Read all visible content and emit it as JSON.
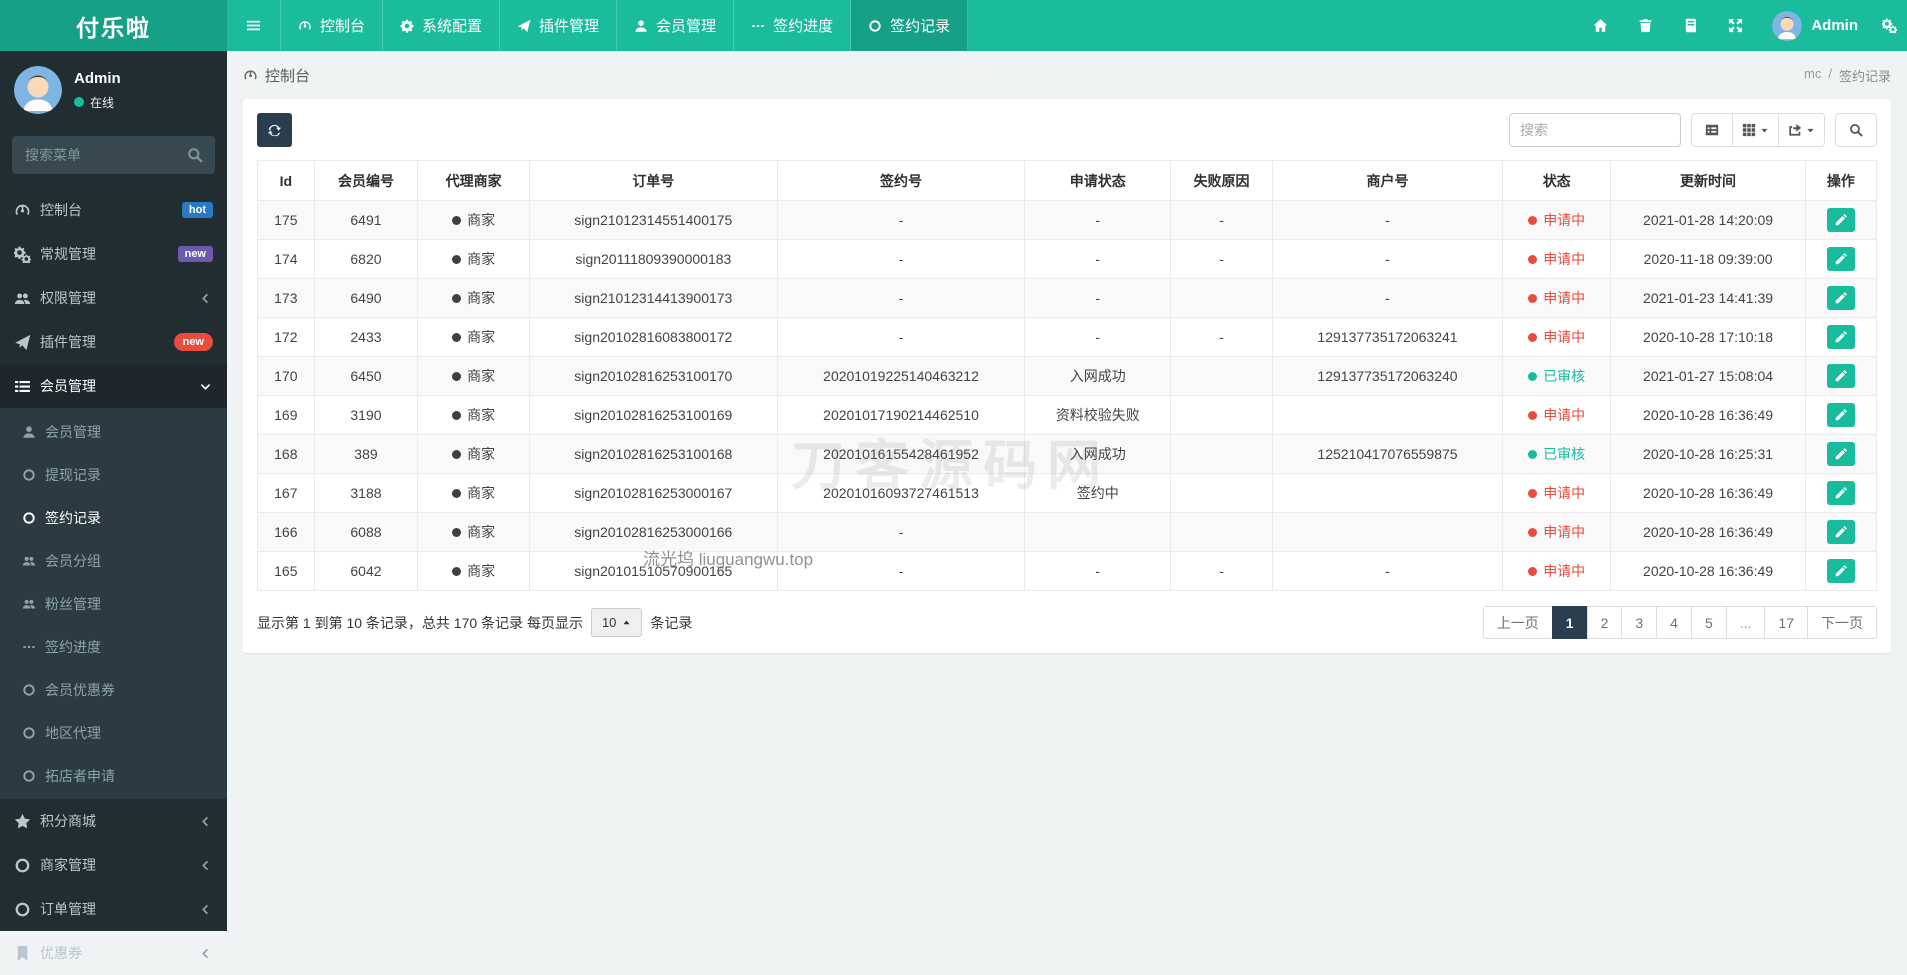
{
  "colors": {
    "navbar_teal": "#1abc9c",
    "navbar_dark_teal": "#16a085",
    "sidebar_dark": "#222d32",
    "navy": "#2b3e50",
    "status_red": "#e74c3c",
    "status_green": "#18bc9c",
    "badge_blue": "#2979c3",
    "badge_purple": "#6c5ab0",
    "badge_red": "#e74c3c"
  },
  "navbar": {
    "brand": "付乐啦",
    "tabs": [
      {
        "label": "控制台",
        "icon": "dashboard",
        "active": false
      },
      {
        "label": "系统配置",
        "icon": "gear",
        "active": false
      },
      {
        "label": "插件管理",
        "icon": "send",
        "active": false
      },
      {
        "label": "会员管理",
        "icon": "user",
        "active": false
      },
      {
        "label": "签约进度",
        "icon": "ellipsis",
        "active": false
      },
      {
        "label": "签约记录",
        "icon": "circle",
        "active": true
      }
    ],
    "right_icons": [
      "home",
      "trash",
      "logs",
      "expand"
    ],
    "user_label": "Admin",
    "settings_icon": "gears"
  },
  "sidebar": {
    "user": {
      "name": "Admin",
      "status": "在线"
    },
    "search_placeholder": "搜索菜单",
    "menu": [
      {
        "label": "控制台",
        "icon": "dashboard",
        "badge": {
          "text": "hot",
          "type": "blue"
        }
      },
      {
        "label": "常规管理",
        "icon": "gears",
        "badge": {
          "text": "new",
          "type": "purple"
        }
      },
      {
        "label": "权限管理",
        "icon": "users",
        "chevron": "left"
      },
      {
        "label": "插件管理",
        "icon": "send",
        "badge": {
          "text": "new",
          "type": "red-pill"
        }
      },
      {
        "label": "会员管理",
        "icon": "list",
        "chevron": "down",
        "open": true,
        "children": [
          {
            "label": "会员管理",
            "icon": "user"
          },
          {
            "label": "提现记录",
            "icon": "circle"
          },
          {
            "label": "签约记录",
            "icon": "circle",
            "active": true
          },
          {
            "label": "会员分组",
            "icon": "users"
          },
          {
            "label": "粉丝管理",
            "icon": "users"
          },
          {
            "label": "签约进度",
            "icon": "ellipsis"
          },
          {
            "label": "会员优惠券",
            "icon": "circle"
          },
          {
            "label": "地区代理",
            "icon": "circle"
          },
          {
            "label": "拓店者申请",
            "icon": "circle"
          }
        ]
      },
      {
        "label": "积分商城",
        "icon": "star",
        "chevron": "left"
      },
      {
        "label": "商家管理",
        "icon": "circle",
        "chevron": "left"
      },
      {
        "label": "订单管理",
        "icon": "circle",
        "chevron": "left"
      },
      {
        "label": "优惠券",
        "icon": "bookmark",
        "chevron": "left"
      }
    ]
  },
  "breadcrumb": {
    "left": "控制台",
    "path": [
      "mc",
      "签约记录"
    ]
  },
  "toolbar": {
    "search_placeholder": "搜索"
  },
  "table": {
    "columns": [
      "Id",
      "会员编号",
      "代理商家",
      "订单号",
      "签约号",
      "申请状态",
      "失败原因",
      "商户号",
      "状态",
      "更新时间",
      "操作"
    ],
    "agent_label": "商家",
    "rows": [
      {
        "id": "175",
        "member": "6491",
        "agent": "商家",
        "order": "sign21012314551400175",
        "sign": "-",
        "apply": "-",
        "fail": "-",
        "merchant": "-",
        "status": {
          "text": "申请中",
          "type": "red"
        },
        "time": "2021-01-28 14:20:09"
      },
      {
        "id": "174",
        "member": "6820",
        "agent": "商家",
        "order": "sign20111809390000183",
        "sign": "-",
        "apply": "-",
        "fail": "-",
        "merchant": "-",
        "status": {
          "text": "申请中",
          "type": "red"
        },
        "time": "2020-11-18 09:39:00"
      },
      {
        "id": "173",
        "member": "6490",
        "agent": "商家",
        "order": "sign21012314413900173",
        "sign": "-",
        "apply": "-",
        "fail": "",
        "merchant": "-",
        "status": {
          "text": "申请中",
          "type": "red"
        },
        "time": "2021-01-23 14:41:39"
      },
      {
        "id": "172",
        "member": "2433",
        "agent": "商家",
        "order": "sign20102816083800172",
        "sign": "-",
        "apply": "-",
        "fail": "-",
        "merchant": "129137735172063241",
        "status": {
          "text": "申请中",
          "type": "red"
        },
        "time": "2020-10-28 17:10:18"
      },
      {
        "id": "170",
        "member": "6450",
        "agent": "商家",
        "order": "sign20102816253100170",
        "sign": "20201019225140463212",
        "apply": "入网成功",
        "fail": "",
        "merchant": "129137735172063240",
        "status": {
          "text": "已审核",
          "type": "green"
        },
        "time": "2021-01-27 15:08:04"
      },
      {
        "id": "169",
        "member": "3190",
        "agent": "商家",
        "order": "sign20102816253100169",
        "sign": "20201017190214462510",
        "apply": "资料校验失败",
        "fail": "",
        "merchant": "",
        "status": {
          "text": "申请中",
          "type": "red"
        },
        "time": "2020-10-28 16:36:49"
      },
      {
        "id": "168",
        "member": "389",
        "agent": "商家",
        "order": "sign20102816253100168",
        "sign": "20201016155428461952",
        "apply": "入网成功",
        "fail": "",
        "merchant": "125210417076559875",
        "status": {
          "text": "已审核",
          "type": "green"
        },
        "time": "2020-10-28 16:25:31"
      },
      {
        "id": "167",
        "member": "3188",
        "agent": "商家",
        "order": "sign20102816253000167",
        "sign": "20201016093727461513",
        "apply": "签约中",
        "fail": "",
        "merchant": "",
        "status": {
          "text": "申请中",
          "type": "red"
        },
        "time": "2020-10-28 16:36:49"
      },
      {
        "id": "166",
        "member": "6088",
        "agent": "商家",
        "order": "sign20102816253000166",
        "sign": "-",
        "apply": "",
        "fail": "",
        "merchant": "",
        "status": {
          "text": "申请中",
          "type": "red"
        },
        "time": "2020-10-28 16:36:49"
      },
      {
        "id": "165",
        "member": "6042",
        "agent": "商家",
        "order": "sign20101510570900165",
        "sign": "-",
        "apply": "-",
        "fail": "-",
        "merchant": "-",
        "status": {
          "text": "申请中",
          "type": "red"
        },
        "time": "2020-10-28 16:36:49"
      }
    ]
  },
  "footer": {
    "info_prefix": "显示第 1 到第 10 条记录，总共 170 条记录 每页显示",
    "page_size": "10",
    "info_suffix": "条记录"
  },
  "pagination": {
    "items": [
      "上一页",
      "1",
      "2",
      "3",
      "4",
      "5",
      "...",
      "17",
      "下一页"
    ],
    "active": "1"
  },
  "watermarks": {
    "big": "刀客源码网",
    "small": "流光坞 liuguangwu.top"
  }
}
